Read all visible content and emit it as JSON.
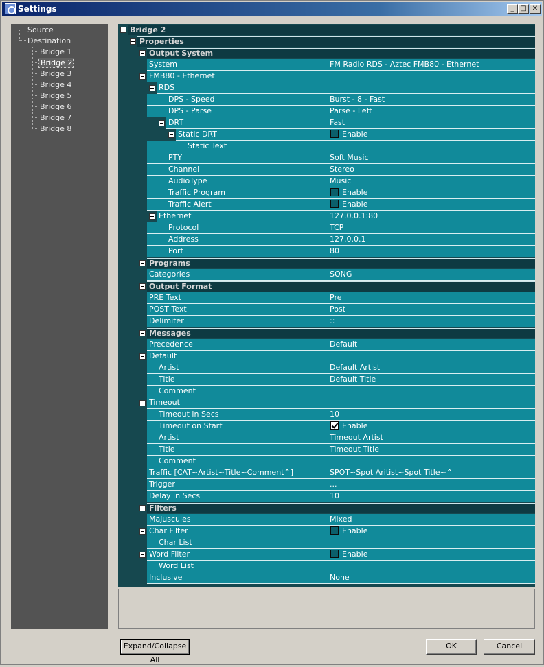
{
  "window": {
    "title": "Settings",
    "minimize_label": "_",
    "maximize_label": "□",
    "close_label": "✕"
  },
  "tree": {
    "root1": "Source",
    "root2": "Destination",
    "children": [
      "Bridge 1",
      "Bridge 2",
      "Bridge 3",
      "Bridge 4",
      "Bridge 5",
      "Bridge 6",
      "Bridge 7",
      "Bridge 8"
    ],
    "selected": "Bridge 2"
  },
  "grid": {
    "bridge": "Bridge 2",
    "properties": "Properties",
    "output_system": "Output System",
    "system_label": "System",
    "system_value": "FM Radio RDS - Aztec FMB80 - Ethernet",
    "fmb80": "FMB80 - Ethernet",
    "rds": "RDS",
    "dps_speed_label": "DPS - Speed",
    "dps_speed_value": "Burst - 8 - Fast",
    "dps_parse_label": "DPS - Parse",
    "dps_parse_value": "Parse - Left",
    "drt_label": "DRT",
    "drt_value": "Fast",
    "static_drt_label": "Static DRT",
    "enable": "Enable",
    "static_text_label": "Static Text",
    "pty_label": "PTY",
    "pty_value": "Soft Music",
    "channel_label": "Channel",
    "channel_value": "Stereo",
    "audiotype_label": "AudioType",
    "audiotype_value": "Music",
    "traffic_program_label": "Traffic Program",
    "traffic_alert_label": "Traffic Alert",
    "ethernet_label": "Ethernet",
    "ethernet_value": "127.0.0.1:80",
    "protocol_label": "Protocol",
    "protocol_value": "TCP",
    "address_label": "Address",
    "address_value": "127.0.0.1",
    "port_label": "Port",
    "port_value": "80",
    "programs": "Programs",
    "categories_label": "Categories",
    "categories_value": "SONG",
    "output_format": "Output Format",
    "pre_text_label": "PRE Text",
    "pre_text_value": "Pre",
    "post_text_label": "POST Text",
    "post_text_value": "Post",
    "delimiter_label": "Delimiter",
    "delimiter_value": "::",
    "messages": "Messages",
    "precedence_label": "Precedence",
    "precedence_value": "Default",
    "default_label": "Default",
    "artist_label": "Artist",
    "default_artist_value": "Default Artist",
    "title_label": "Title",
    "default_title_value": "Default Title",
    "comment_label": "Comment",
    "timeout_label": "Timeout",
    "timeout_secs_label": "Timeout in Secs",
    "timeout_secs_value": "10",
    "timeout_start_label": "Timeout on Start",
    "timeout_artist_value": "Timeout Artist",
    "timeout_title_value": "Timeout Title",
    "traffic_label": "Traffic [CAT~Artist~Title~Comment^]",
    "traffic_value": "SPOT~Spot Aritist~Spot Title~^",
    "trigger_label": "Trigger",
    "trigger_value": "...",
    "delay_label": "Delay in Secs",
    "delay_value": "10",
    "filters": "Filters",
    "majuscules_label": "Majuscules",
    "majuscules_value": "Mixed",
    "char_filter_label": "Char Filter",
    "char_list_label": "Char List",
    "word_filter_label": "Word Filter",
    "word_list_label": "Word List",
    "inclusive_label": "Inclusive",
    "inclusive_value": "None"
  },
  "buttons": {
    "expand_collapse": "Expand/Collapse All",
    "ok": "OK",
    "cancel": "Cancel"
  }
}
